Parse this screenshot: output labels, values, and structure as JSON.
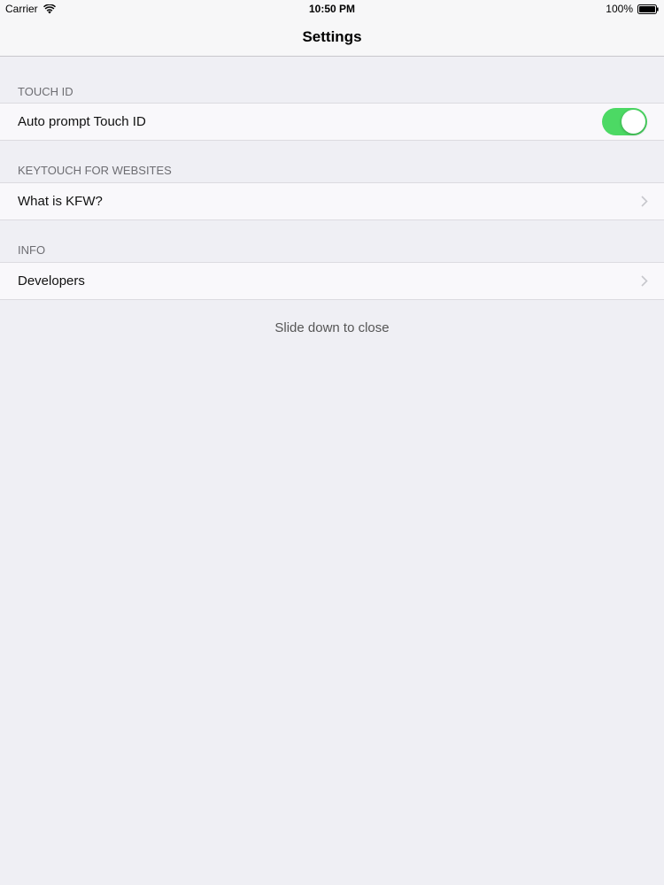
{
  "status_bar": {
    "carrier": "Carrier",
    "time": "10:50 PM",
    "battery": "100%",
    "wifi_icon": "wifi-icon",
    "battery_icon": "battery-icon"
  },
  "nav": {
    "title": "Settings"
  },
  "sections": [
    {
      "header": "TOUCH ID",
      "rows": [
        {
          "label": "Auto prompt Touch ID",
          "accessory": "toggle",
          "toggle_on": true
        }
      ]
    },
    {
      "header": "KEYTOUCH FOR WEBSITES",
      "rows": [
        {
          "label": "What is KFW?",
          "accessory": "chevron-right-icon"
        }
      ]
    },
    {
      "header": "INFO",
      "rows": [
        {
          "label": "Developers",
          "accessory": "chevron-right-icon"
        }
      ]
    }
  ],
  "footer": {
    "hint": "Slide down to close"
  },
  "colors": {
    "background": "#efeff4",
    "cell_background": "#f9f8fb",
    "toggle_on": "#4cd964",
    "section_header_text": "#6d6d72",
    "chevron": "#c7c7cc"
  }
}
